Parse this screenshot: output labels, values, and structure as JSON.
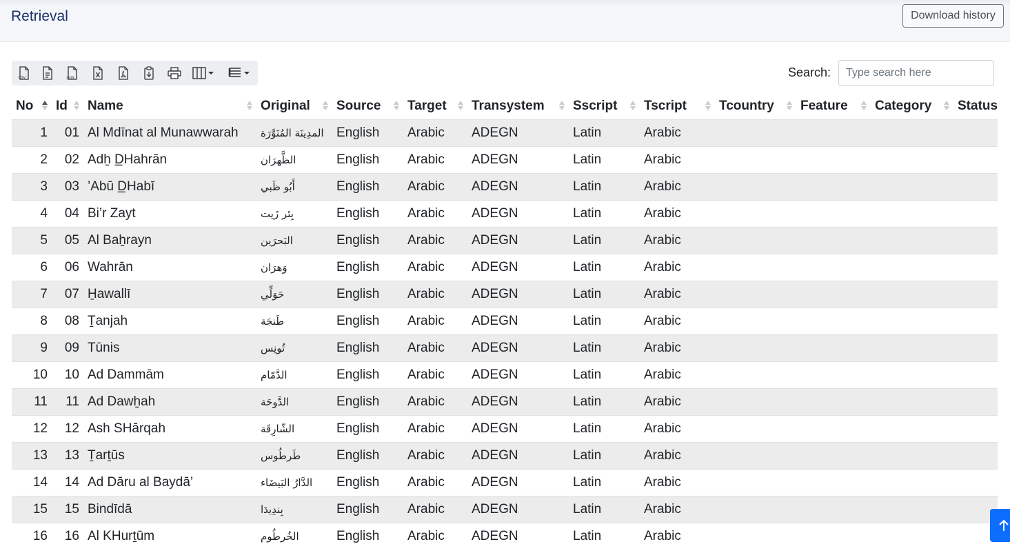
{
  "header": {
    "title": "Retrieval",
    "download_label": "Download history"
  },
  "toolbar": {
    "icons": [
      "csv-export-icon",
      "file-text-icon",
      "json-export-icon",
      "excel-export-icon",
      "pdf-export-icon",
      "clipboard-icon",
      "print-icon",
      "column-visibility-icon",
      "page-length-icon"
    ]
  },
  "search": {
    "label": "Search:",
    "placeholder": "Type search here"
  },
  "table": {
    "columns": [
      "No",
      "Id",
      "Name",
      "Original",
      "Source",
      "Target",
      "Transystem",
      "Sscript",
      "Tscript",
      "Tcountry",
      "Feature",
      "Category",
      "Status"
    ],
    "sorted_column": "No",
    "rows": [
      [
        "1",
        "01",
        "Al Mdīnat al Munawwarah",
        "المدِينَة المُنَوَّرَة",
        "English",
        "Arabic",
        "ADEGN",
        "Latin",
        "Arabic",
        "",
        "",
        "",
        ""
      ],
      [
        "2",
        "02",
        "Adẖ D̲Hahrān",
        "الظَّهرَان",
        "English",
        "Arabic",
        "ADEGN",
        "Latin",
        "Arabic",
        "",
        "",
        "",
        ""
      ],
      [
        "3",
        "03",
        "’Abū D̲Habī",
        "أَبُو ظَبي",
        "English",
        "Arabic",
        "ADEGN",
        "Latin",
        "Arabic",
        "",
        "",
        "",
        ""
      ],
      [
        "4",
        "04",
        "Bi’r Zayt",
        "بِئر زَيت",
        "English",
        "Arabic",
        "ADEGN",
        "Latin",
        "Arabic",
        "",
        "",
        "",
        ""
      ],
      [
        "5",
        "05",
        "Al Baẖrayn",
        "البَحرَين",
        "English",
        "Arabic",
        "ADEGN",
        "Latin",
        "Arabic",
        "",
        "",
        "",
        ""
      ],
      [
        "6",
        "06",
        "Wahrān",
        "وَهرَان",
        "English",
        "Arabic",
        "ADEGN",
        "Latin",
        "Arabic",
        "",
        "",
        "",
        ""
      ],
      [
        "7",
        "07",
        "H̱awallī",
        "حَوَلِّي",
        "English",
        "Arabic",
        "ADEGN",
        "Latin",
        "Arabic",
        "",
        "",
        "",
        ""
      ],
      [
        "8",
        "08",
        "Ṯanjah",
        "طَنجَة",
        "English",
        "Arabic",
        "ADEGN",
        "Latin",
        "Arabic",
        "",
        "",
        "",
        ""
      ],
      [
        "9",
        "09",
        "Tūnis",
        "تُونِس",
        "English",
        "Arabic",
        "ADEGN",
        "Latin",
        "Arabic",
        "",
        "",
        "",
        ""
      ],
      [
        "10",
        "10",
        "Ad Dammām",
        "الدَّمّام",
        "English",
        "Arabic",
        "ADEGN",
        "Latin",
        "Arabic",
        "",
        "",
        "",
        ""
      ],
      [
        "11",
        "11",
        "Ad Dawẖah",
        "الدَّوحَة",
        "English",
        "Arabic",
        "ADEGN",
        "Latin",
        "Arabic",
        "",
        "",
        "",
        ""
      ],
      [
        "12",
        "12",
        "Ash SHārqah",
        "الشّارِقَة",
        "English",
        "Arabic",
        "ADEGN",
        "Latin",
        "Arabic",
        "",
        "",
        "",
        ""
      ],
      [
        "13",
        "13",
        "Ṯarṯūs",
        "طَرطُوس",
        "English",
        "Arabic",
        "ADEGN",
        "Latin",
        "Arabic",
        "",
        "",
        "",
        ""
      ],
      [
        "14",
        "14",
        "Ad Dāru al Baydā’",
        "الدَّارُ البَيضَاء",
        "English",
        "Arabic",
        "ADEGN",
        "Latin",
        "Arabic",
        "",
        "",
        "",
        ""
      ],
      [
        "15",
        "15",
        "Bindīdā",
        "بِندِيدَا",
        "English",
        "Arabic",
        "ADEGN",
        "Latin",
        "Arabic",
        "",
        "",
        "",
        ""
      ],
      [
        "16",
        "16",
        "Al KHurṯūm",
        "الخُرطُوم",
        "English",
        "Arabic",
        "ADEGN",
        "Latin",
        "Arabic",
        "",
        "",
        "",
        ""
      ]
    ]
  },
  "scroll_top": {
    "icon": "arrow-up-icon"
  },
  "colors": {
    "accent": "#0d6efd",
    "title": "#1a2f6b",
    "stripe": "#ececec"
  }
}
